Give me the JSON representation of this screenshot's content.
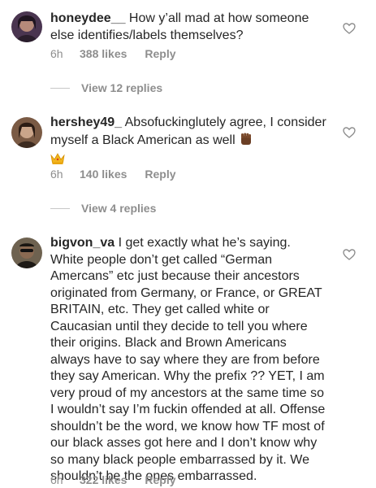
{
  "comments": [
    {
      "username": "honeydee__",
      "text": " How y’all mad at how someone else identifies/labels themselves?",
      "time": "6h",
      "likes": "388 likes",
      "reply": "Reply",
      "view_replies": "View 12 replies",
      "avatar_colors": [
        "#3b2a3f",
        "#8a5a8c"
      ]
    },
    {
      "username": "hershey49_",
      "text": " Absofuckinglutely agree, I consider myself a Black American as well",
      "time": "6h",
      "likes": "140 likes",
      "reply": "Reply",
      "view_replies": "View 4 replies",
      "avatar_colors": [
        "#5a3e2e",
        "#c8a48a"
      ]
    },
    {
      "username": "bigvon_va",
      "text": " I get exactly what he’s saying. White people don’t get called “German Amercans” etc just because their ancestors originated from Germany, or France, or GREAT BRITAIN, etc. They get called white or Caucasian until they decide to tell you where their origins.  Black and Brown Americans always have to say where they are from before they say American.  Why the prefix ?? YET, I am very proud of my ancestors at the same time so I wouldn’t say I’m fuckin offended at all.  Offense shouldn’t be the word, we know how TF most of our black asses got here and I don’t know why so many black people embarrassed by it. We shouldn’t be the ones embarrassed.",
      "time": "6h",
      "likes": "322 likes",
      "reply": "Reply",
      "avatar_colors": [
        "#2e2a26",
        "#9b8a6e"
      ]
    }
  ],
  "emojis": [
    "raised-fist-dark-skin",
    "crown"
  ],
  "colors": {
    "text": "#262626",
    "muted": "#8e8e8e",
    "divider": "#c7c7c7"
  }
}
